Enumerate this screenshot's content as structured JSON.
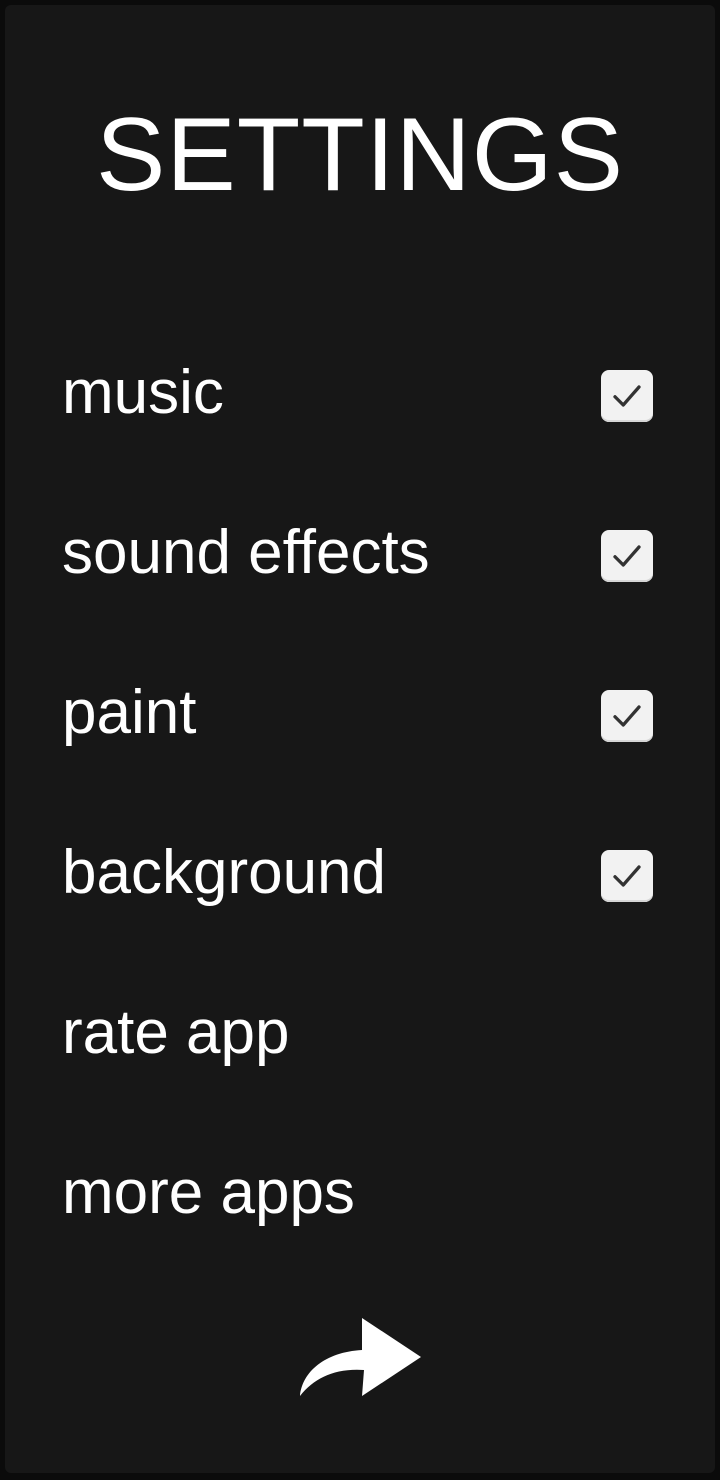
{
  "header": {
    "title": "SETTINGS"
  },
  "settings": {
    "items": [
      {
        "label": "music",
        "checked": true
      },
      {
        "label": "sound effects",
        "checked": true
      },
      {
        "label": "paint",
        "checked": true
      },
      {
        "label": "background",
        "checked": true
      },
      {
        "label": "rate app"
      },
      {
        "label": "more apps"
      }
    ]
  },
  "footer": {
    "back_icon": "share-arrow-icon"
  },
  "colors": {
    "background": "#171717",
    "text": "#ffffff",
    "checkbox": "#f2f2f2",
    "checkmark": "#333333"
  }
}
